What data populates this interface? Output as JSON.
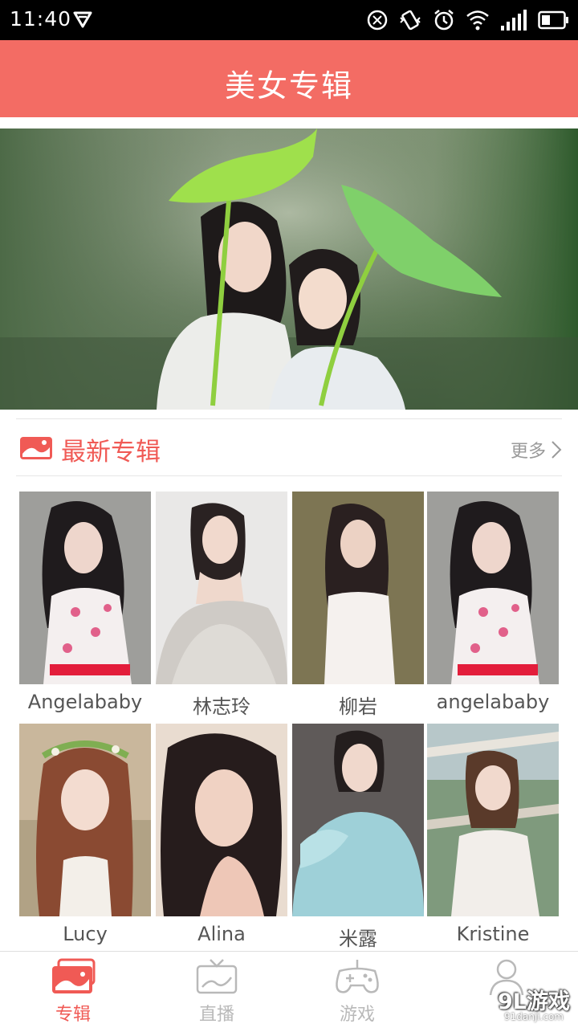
{
  "status_bar": {
    "time": "11:40"
  },
  "header": {
    "title": "美女专辑"
  },
  "section": {
    "title": "最新专辑",
    "more_label": "更多"
  },
  "albums": [
    {
      "name": "Angelababy"
    },
    {
      "name": "林志玲"
    },
    {
      "name": "柳岩"
    },
    {
      "name": "angelababy"
    },
    {
      "name": "Lucy"
    },
    {
      "name": "Alina"
    },
    {
      "name": "米露"
    },
    {
      "name": "Kristine"
    }
  ],
  "tabs": [
    {
      "label": "专辑",
      "icon": "album-icon",
      "active": true
    },
    {
      "label": "直播",
      "icon": "tv-icon",
      "active": false
    },
    {
      "label": "游戏",
      "icon": "gamepad-icon",
      "active": false
    },
    {
      "label": "",
      "icon": "user-icon",
      "active": false
    }
  ],
  "watermark": {
    "main": "9L游戏",
    "sub": "91danji.com"
  },
  "colors": {
    "accent": "#f36c64",
    "accent_text": "#f05a55",
    "tab_inactive": "#b9b9b9"
  }
}
